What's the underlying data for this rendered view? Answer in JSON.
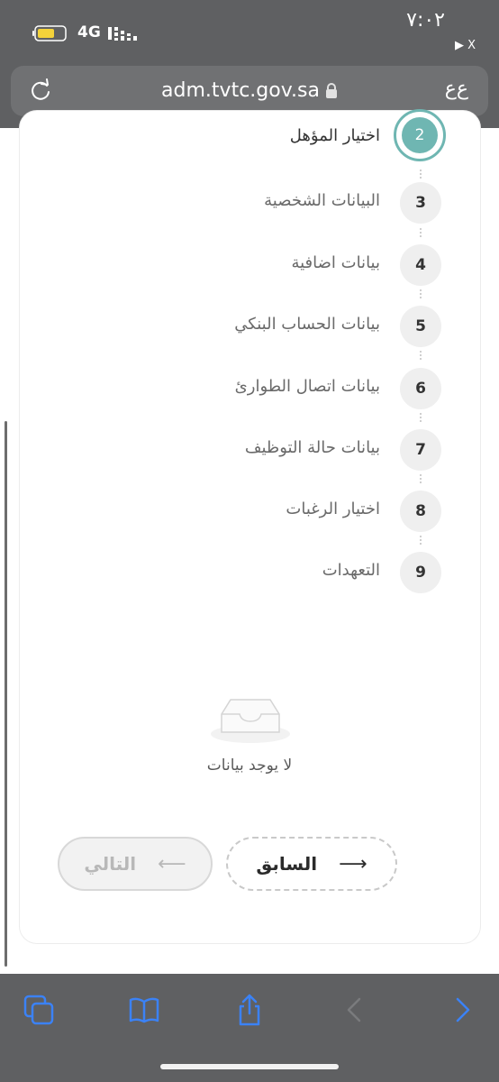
{
  "status_bar": {
    "time": "٧:٠٢",
    "back_app": "▶ X",
    "network": "4G"
  },
  "browser": {
    "url": "adm.tvtc.gov.sa",
    "text_size_button": "ﻉﻉ"
  },
  "steps": [
    {
      "number": "2",
      "label": "اختيار المؤهل",
      "state": "active"
    },
    {
      "number": "3",
      "label": "البيانات الشخصية",
      "state": "pending"
    },
    {
      "number": "4",
      "label": "بيانات اضافية",
      "state": "pending"
    },
    {
      "number": "5",
      "label": "بيانات الحساب البنكي",
      "state": "pending"
    },
    {
      "number": "6",
      "label": "بيانات اتصال الطوارئ",
      "state": "pending"
    },
    {
      "number": "7",
      "label": "بيانات حالة التوظيف",
      "state": "pending"
    },
    {
      "number": "8",
      "label": "اختيار الرغبات",
      "state": "pending"
    },
    {
      "number": "9",
      "label": "التعهدات",
      "state": "pending"
    }
  ],
  "empty_state": {
    "text": "لا يوجد بيانات",
    "icon": "inbox-icon"
  },
  "buttons": {
    "previous_label": "السابق",
    "next_label": "التالي"
  },
  "colors": {
    "accent": "#6fb6b2",
    "chrome": "#5f6062",
    "toolbar_icon": "#3b82f6"
  }
}
